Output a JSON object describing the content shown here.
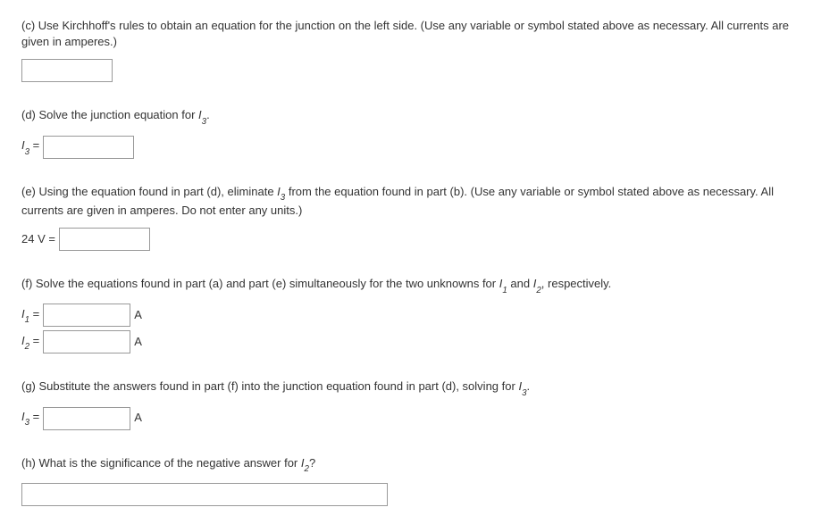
{
  "parts": {
    "c": {
      "prompt_before": "(c) Use Kirchhoff's rules to obtain an equation for the junction on the left side. (Use any variable or symbol stated above as necessary. All currents are given in amperes.)"
    },
    "d": {
      "prompt_plain_before": "(d) Solve the junction equation for ",
      "var_base": "I",
      "var_sub": "3",
      "prompt_plain_after": ".",
      "eq_label_base": "I",
      "eq_label_sub": "3",
      "eq_equals": " ="
    },
    "e": {
      "prompt_before": "(e) Using the equation found in part (d), eliminate ",
      "var_base": "I",
      "var_sub": "3",
      "prompt_after": " from the equation found in part (b). (Use any variable or symbol stated above as necessary. All currents are given in amperes. Do not enter any units.)",
      "eq_label": "24 V ="
    },
    "f": {
      "prompt_before": "(f) Solve the equations found in part (a) and part (e) simultaneously for the two unknowns for ",
      "var1_base": "I",
      "var1_sub": "1",
      "mid": " and ",
      "var2_base": "I",
      "var2_sub": "2",
      "prompt_after": ", respectively.",
      "row1_base": "I",
      "row1_sub": "1",
      "row1_eq": " =",
      "row1_unit": "A",
      "row2_base": "I",
      "row2_sub": "2",
      "row2_eq": " =",
      "row2_unit": "A"
    },
    "g": {
      "prompt_before": "(g) Substitute the answers found in part (f) into the junction equation found in part (d), solving for ",
      "var_base": "I",
      "var_sub": "3",
      "prompt_after": ".",
      "row_base": "I",
      "row_sub": "3",
      "row_eq": " =",
      "row_unit": "A"
    },
    "h": {
      "prompt_before": "(h) What is the significance of the negative answer for ",
      "var_base": "I",
      "var_sub": "2",
      "prompt_after": "?"
    }
  }
}
